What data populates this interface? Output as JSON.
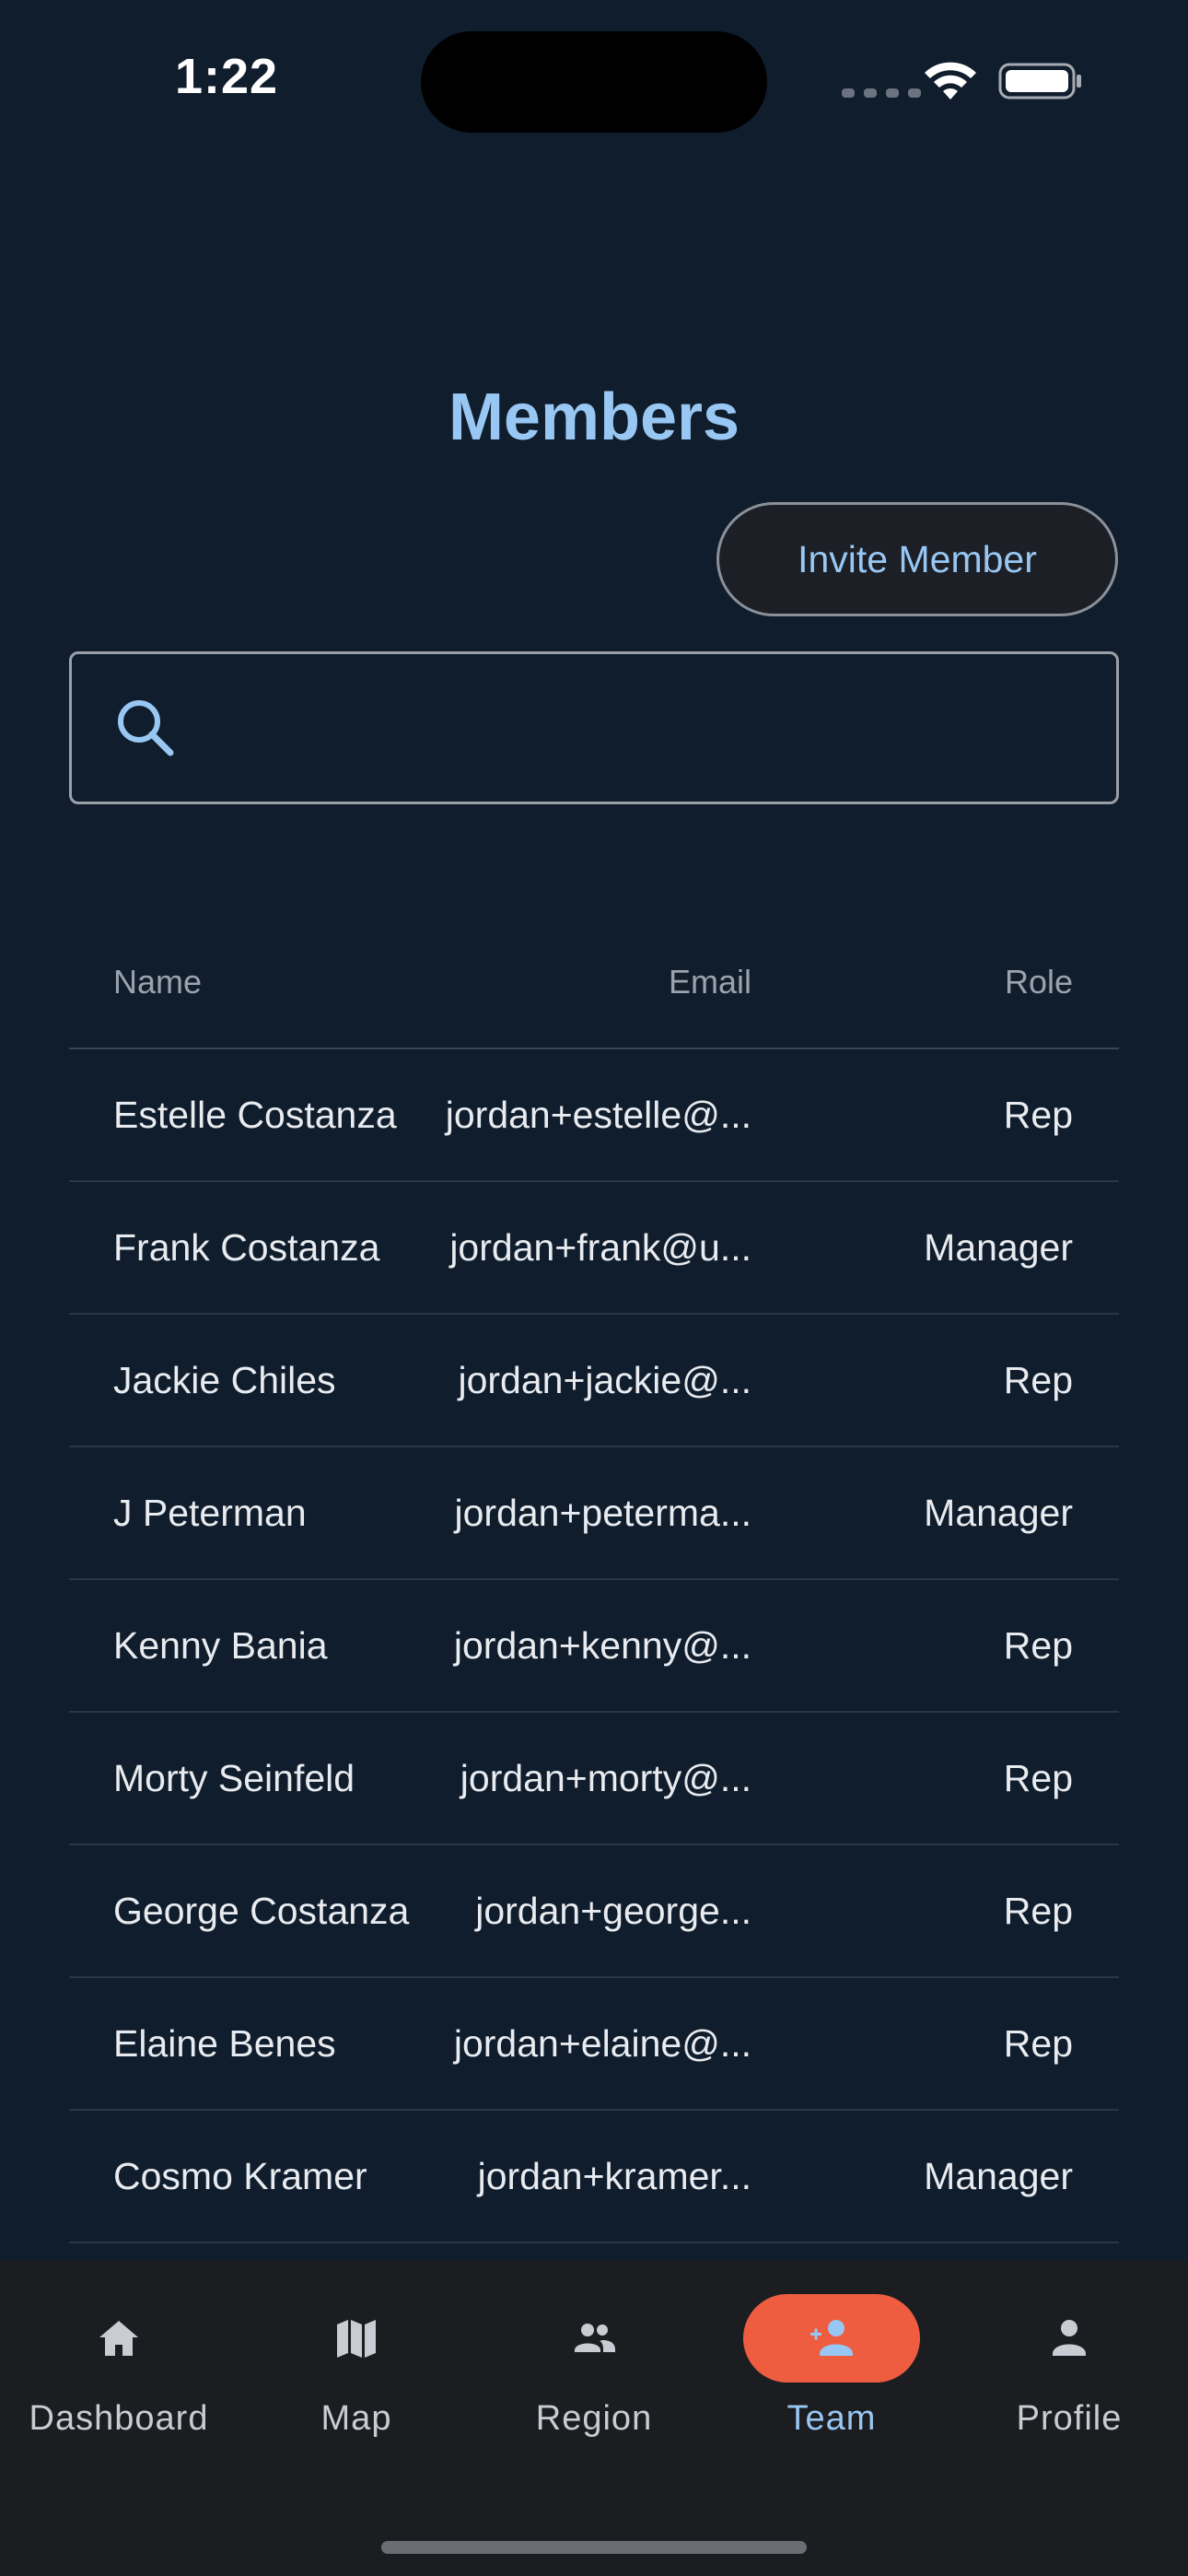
{
  "status_bar": {
    "time": "1:22"
  },
  "header": {
    "title": "Members"
  },
  "actions": {
    "invite_label": "Invite Member"
  },
  "search": {
    "value": "",
    "placeholder": ""
  },
  "table": {
    "columns": {
      "name": "Name",
      "email": "Email",
      "role": "Role"
    },
    "rows": [
      {
        "name": "Estelle Costanza",
        "email": "jordan+estelle@...",
        "role": "Rep"
      },
      {
        "name": "Frank Costanza",
        "email": "jordan+frank@u...",
        "role": "Manager"
      },
      {
        "name": "Jackie Chiles",
        "email": "jordan+jackie@...",
        "role": "Rep"
      },
      {
        "name": "J Peterman",
        "email": "jordan+peterma...",
        "role": "Manager"
      },
      {
        "name": "Kenny Bania",
        "email": "jordan+kenny@...",
        "role": "Rep"
      },
      {
        "name": "Morty Seinfeld",
        "email": "jordan+morty@...",
        "role": "Rep"
      },
      {
        "name": "George Costanza",
        "email": "jordan+george...",
        "role": "Rep"
      },
      {
        "name": "Elaine Benes",
        "email": "jordan+elaine@...",
        "role": "Rep"
      },
      {
        "name": "Cosmo Kramer",
        "email": "jordan+kramer...",
        "role": "Manager"
      }
    ]
  },
  "nav": {
    "items": [
      {
        "label": "Dashboard",
        "icon": "home-icon"
      },
      {
        "label": "Map",
        "icon": "map-icon"
      },
      {
        "label": "Region",
        "icon": "group-icon"
      },
      {
        "label": "Team",
        "icon": "person-add-icon",
        "active": true
      },
      {
        "label": "Profile",
        "icon": "person-icon"
      }
    ]
  },
  "colors": {
    "background": "#101d2c",
    "accent": "#98c7f3",
    "active_pill": "#ee5d3f",
    "nav_background": "#1c1d21"
  }
}
